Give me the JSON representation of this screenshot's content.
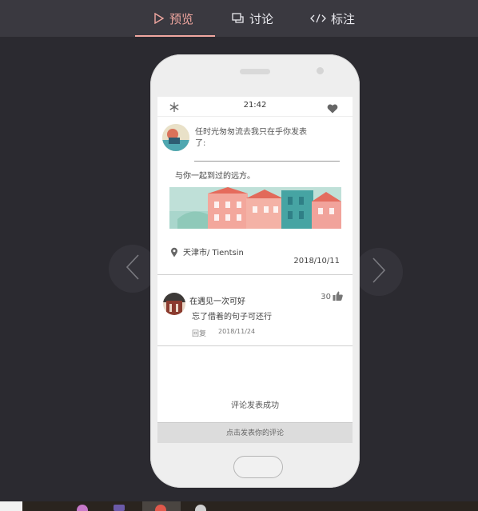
{
  "tabs": [
    {
      "label": "预览",
      "icon": "play-icon",
      "active": true
    },
    {
      "label": "讨论",
      "icon": "chat-icon",
      "active": false
    },
    {
      "label": "标注",
      "icon": "code-icon",
      "active": false
    }
  ],
  "colors": {
    "accent": "#f1a7a0",
    "background": "#2b2a30",
    "topbar": "#3a3940"
  },
  "phone": {
    "status": {
      "time": "21:42",
      "left_icon": "snowflake-icon",
      "right_icon": "heart-icon"
    },
    "post": {
      "title": "任时光匆匆流去我只在乎你发表了:",
      "text": "与你一起到过的远方。",
      "location": "天津市/ Tientsin",
      "date": "2018/10/11"
    },
    "comment": {
      "name": "在遇见一次可好",
      "likes": "30",
      "text": "忘了借着的句子可还行",
      "reply_label": "回复",
      "date": "2018/11/24"
    },
    "success_message": "评论发表成功",
    "comment_bar": "点击发表你的评论"
  }
}
